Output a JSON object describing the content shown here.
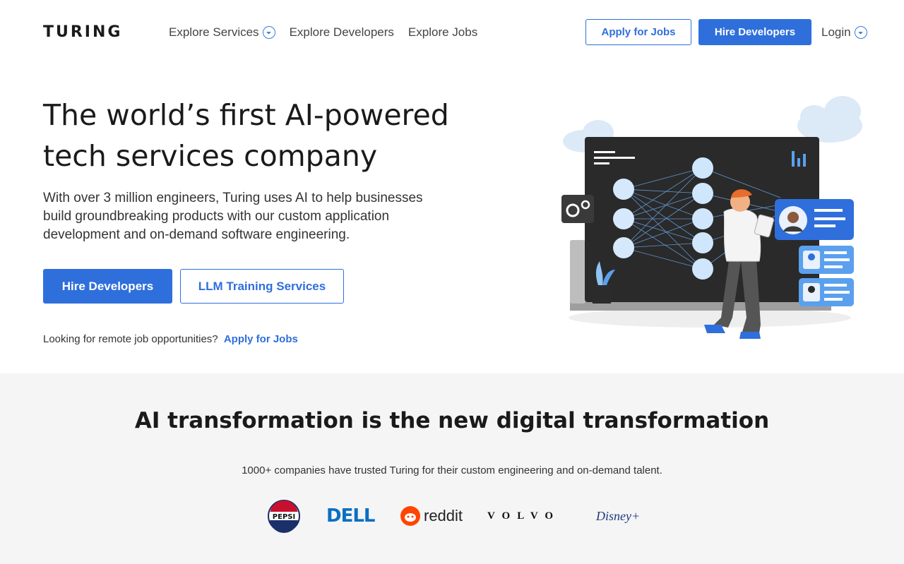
{
  "header": {
    "logo": "TURING",
    "nav": [
      {
        "label": "Explore Services",
        "has_dropdown": true
      },
      {
        "label": "Explore Developers",
        "has_dropdown": false
      },
      {
        "label": "Explore Jobs",
        "has_dropdown": false
      }
    ],
    "apply_jobs_label": "Apply for Jobs",
    "hire_developers_label": "Hire Developers",
    "login_label": "Login"
  },
  "hero": {
    "title_line1": "The world’s first AI-powered",
    "title_line2": "tech services company",
    "description": "With over 3 million engineers, Turing uses AI to help businesses build groundbreaking products with our custom application development and on-demand software engineering.",
    "primary_button": "Hire Developers",
    "secondary_button": "LLM Training Services",
    "remote_text": "Looking for remote job opportunities?",
    "remote_link": "Apply for Jobs"
  },
  "transformation": {
    "title": "AI transformation is the new digital transformation",
    "subtitle": "1000+ companies have trusted Turing for their custom engineering and on-demand talent.",
    "logos": [
      {
        "name": "PEPSI"
      },
      {
        "name": "DELL"
      },
      {
        "name": "reddit"
      },
      {
        "name": "VOLVO"
      },
      {
        "name": "Disney+"
      }
    ]
  },
  "colors": {
    "accent": "#2f6fdc",
    "section_bg": "#f5f5f5"
  }
}
